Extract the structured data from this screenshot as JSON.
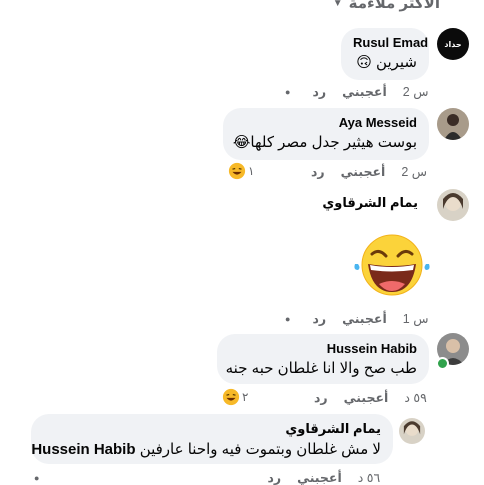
{
  "sort": {
    "label": "الأكثر ملاءمة"
  },
  "comments": [
    {
      "author": "Rusul Emad",
      "avatar_text": "حداد",
      "text": "شيرين 🙃",
      "time": "2 س",
      "like": "أعجبني",
      "reply": "رد"
    },
    {
      "author": "Aya Messeid",
      "text": "بوست هيثير جدل مصر كلها😂",
      "time": "2 س",
      "like": "أعجبني",
      "reply": "رد",
      "reactions": "١"
    },
    {
      "author": "يمام الشرقاوي",
      "text": "",
      "sticker": "laughing-tears-sticker",
      "time": "1 س",
      "like": "أعجبني",
      "reply": "رد"
    },
    {
      "author": "Hussein Habib",
      "text": "طب صح والا انا غلطان حبه جنه",
      "time": "٥٩ د",
      "like": "أعجبني",
      "reply": "رد",
      "reactions": "٢"
    },
    {
      "author": "يمام الشرقاوي",
      "mention": "Hussein Habib",
      "text": "لا مش غلطان وبتموت فيه واحنا عارفين",
      "time": "٥٦ د",
      "like": "أعجبني",
      "reply": "رد"
    }
  ],
  "colors": {
    "bubble": "#f0f2f5",
    "meta": "#65676b",
    "online": "#31a24c"
  }
}
